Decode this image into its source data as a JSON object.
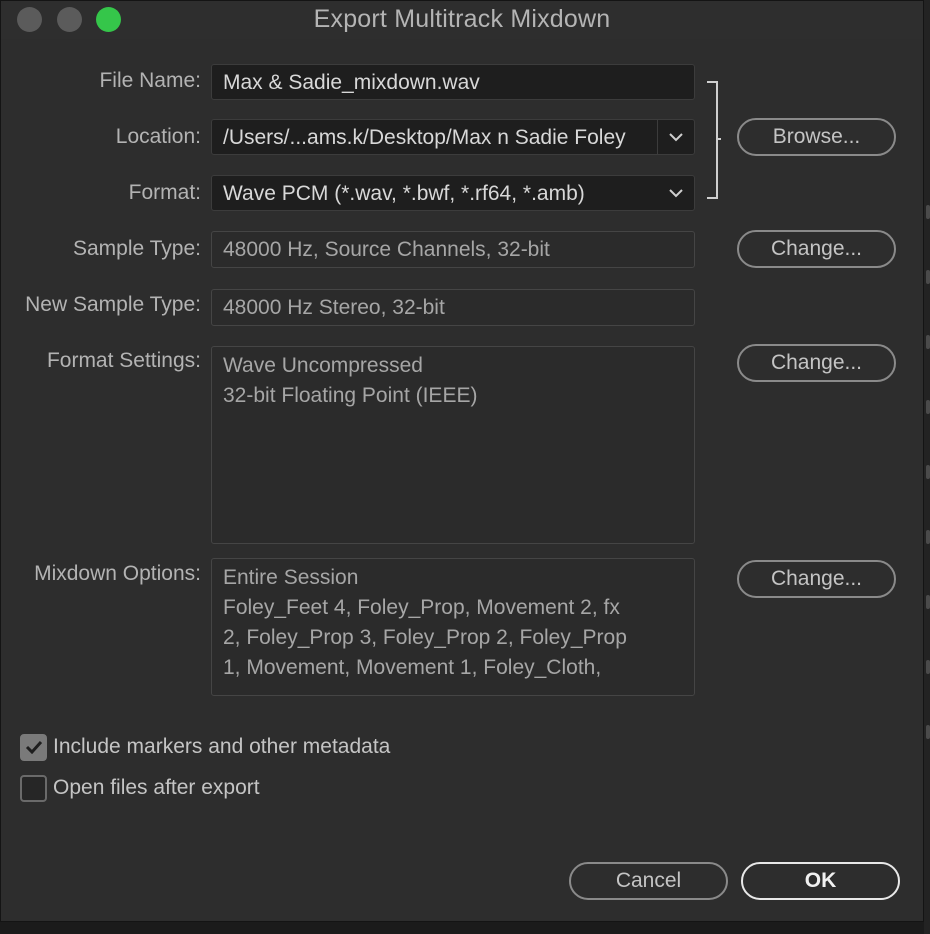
{
  "window": {
    "title": "Export Multitrack Mixdown",
    "traffic_lights": [
      "close",
      "minimize",
      "zoom"
    ]
  },
  "fields": {
    "file_name": {
      "label": "File Name:",
      "value": "Max & Sadie_mixdown.wav"
    },
    "location": {
      "label": "Location:",
      "value": "/Users/...ams.k/Desktop/Max n Sadie Foley"
    },
    "format": {
      "label": "Format:",
      "value": "Wave PCM (*.wav, *.bwf, *.rf64, *.amb)"
    },
    "sample_type": {
      "label": "Sample Type:",
      "value": "48000 Hz, Source Channels, 32-bit"
    },
    "new_sample_type": {
      "label": "New Sample Type:",
      "value": "48000 Hz Stereo, 32-bit"
    },
    "format_settings": {
      "label": "Format Settings:",
      "lines": [
        "Wave Uncompressed",
        "32-bit Floating Point (IEEE)"
      ]
    },
    "mixdown_options": {
      "label": "Mixdown Options:",
      "lines": [
        "Entire Session",
        "Foley_Feet 4, Foley_Prop, Movement 2, fx",
        "2, Foley_Prop 3, Foley_Prop 2, Foley_Prop",
        "1, Movement, Movement 1, Foley_Cloth,"
      ]
    }
  },
  "buttons": {
    "browse": "Browse...",
    "change_sample_type": "Change...",
    "change_format_settings": "Change...",
    "change_mixdown_options": "Change...",
    "cancel": "Cancel",
    "ok": "OK"
  },
  "options": {
    "include_markers": {
      "label": "Include markers and other metadata",
      "checked": true
    },
    "open_files": {
      "label": "Open files after export",
      "checked": false
    }
  },
  "colors": {
    "dialog_bg": "#2d2d2d",
    "zoom_green": "#35c64a",
    "traffic_gray": "#5b5b5b",
    "primary_button_border": "#e8e8e8"
  }
}
